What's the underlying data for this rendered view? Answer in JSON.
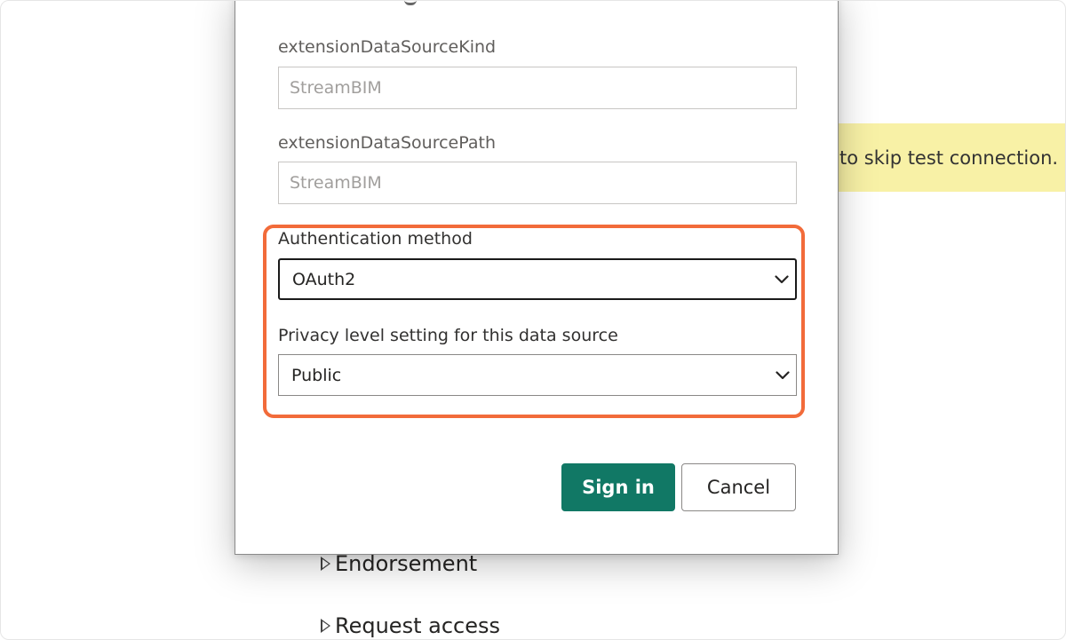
{
  "banner": {
    "text": "to skip test connection."
  },
  "background": {
    "items": [
      {
        "label": "Endorsement"
      },
      {
        "label": "Request access"
      }
    ]
  },
  "dialog": {
    "fields": {
      "kind": {
        "label": "extensionDataSourceKind",
        "value": "StreamBIM"
      },
      "path": {
        "label": "extensionDataSourcePath",
        "value": "StreamBIM"
      }
    },
    "auth": {
      "label": "Authentication method",
      "selected": "OAuth2"
    },
    "privacy": {
      "label": "Privacy level setting for this data source",
      "selected": "Public"
    },
    "buttons": {
      "signin": "Sign in",
      "cancel": "Cancel"
    }
  },
  "colors": {
    "primary": "#117865",
    "highlight": "#f26b3a",
    "banner": "#f8f1a6"
  },
  "icons": {
    "dropdown": "chevron-down-icon",
    "expand": "triangle-right-icon"
  }
}
